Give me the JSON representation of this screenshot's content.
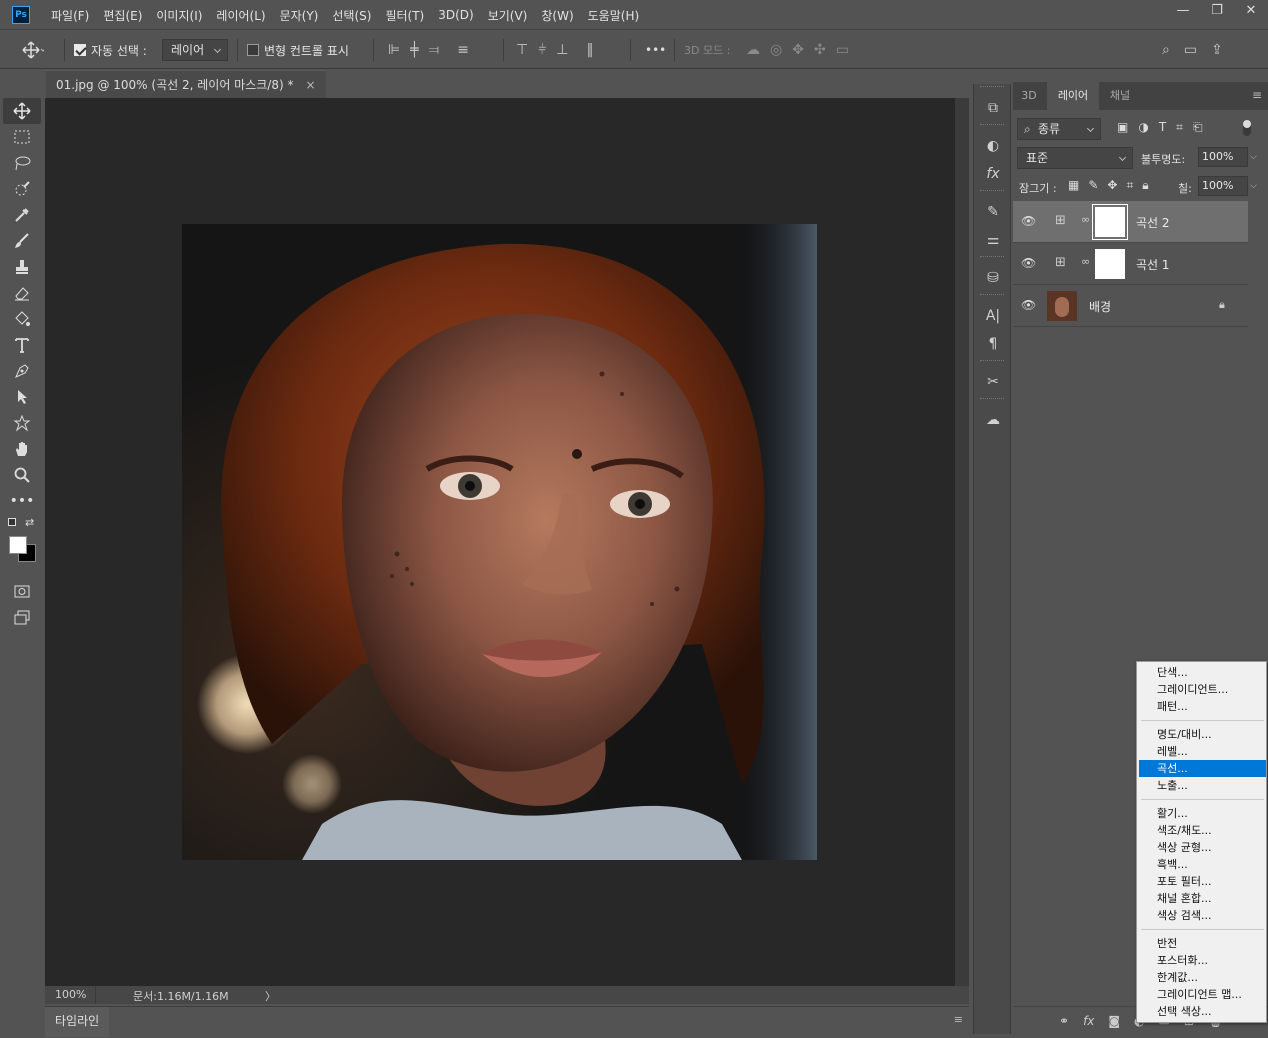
{
  "app": {
    "logo": "Ps",
    "menu": [
      "파일(F)",
      "편집(E)",
      "이미지(I)",
      "레이어(L)",
      "문자(Y)",
      "선택(S)",
      "필터(T)",
      "3D(D)",
      "보기(V)",
      "창(W)",
      "도움말(H)"
    ],
    "window_controls": [
      "—",
      "❐",
      "✕"
    ]
  },
  "options_bar": {
    "auto_select_label": "자동 선택 :",
    "auto_select_checked": true,
    "auto_select_target": "레이어",
    "transform_controls_label": "변형 컨트롤 표시",
    "transform_controls_checked": false,
    "mode_3d_label": "3D 모드 :",
    "more_label": "•••"
  },
  "document": {
    "tab_title": "01.jpg @ 100% (곡선 2, 레이어 마스크/8) *",
    "close_glyph": "×",
    "zoom": "100%",
    "doc_size": "문서:1.16M/1.16M",
    "status_arrow": "〉"
  },
  "timeline": {
    "tab_label": "타임라인",
    "menu_glyph": "≡"
  },
  "panel": {
    "tabs": [
      "3D",
      "레이어",
      "채널"
    ],
    "active_tab": "레이어",
    "filter_kind": "종류",
    "blend_mode": "표준",
    "opacity_label": "불투명도:",
    "opacity_value": "100%",
    "lock_label": "잠그기 :",
    "fill_label": "칠:",
    "fill_value": "100%",
    "layers": [
      {
        "name": "곡선 2",
        "type": "adjustment",
        "selected": true
      },
      {
        "name": "곡선 1",
        "type": "adjustment",
        "selected": false
      },
      {
        "name": "배경",
        "type": "image",
        "selected": false,
        "locked": true
      }
    ]
  },
  "context_menu": {
    "groups": [
      [
        "단색...",
        "그레이디언트...",
        "패턴..."
      ],
      [
        "명도/대비...",
        "레벨...",
        "곡선...",
        "노출..."
      ],
      [
        "활기...",
        "색조/채도...",
        "색상 균형...",
        "흑백...",
        "포토 필터...",
        "채널 혼합...",
        "색상 검색..."
      ],
      [
        "반전",
        "포스터화...",
        "한계값...",
        "그레이디언트 맵...",
        "선택 색상..."
      ]
    ],
    "highlighted": "곡선..."
  },
  "colors": {
    "accent": "#0078d7",
    "bg": "#535353",
    "canvas": "#282828"
  }
}
